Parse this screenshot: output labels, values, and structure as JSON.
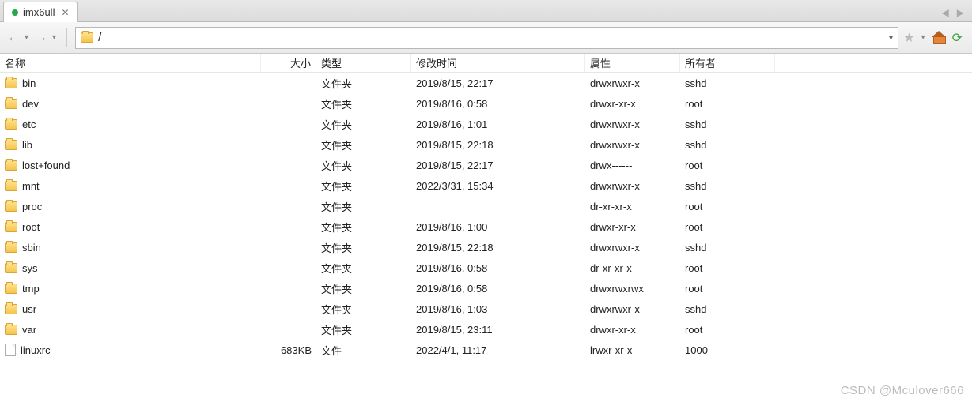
{
  "tab": {
    "title": "imx6ull"
  },
  "navbar": {
    "path": "/"
  },
  "columns": {
    "name": "名称",
    "size": "大小",
    "type": "类型",
    "mtime": "修改时间",
    "attr": "属性",
    "owner": "所有者"
  },
  "type_labels": {
    "folder": "文件夹",
    "file": "文件"
  },
  "rows": [
    {
      "icon": "folder",
      "name": "bin",
      "size": "",
      "type": "文件夹",
      "mtime": "2019/8/15, 22:17",
      "attr": "drwxrwxr-x",
      "owner": "sshd"
    },
    {
      "icon": "folder",
      "name": "dev",
      "size": "",
      "type": "文件夹",
      "mtime": "2019/8/16, 0:58",
      "attr": "drwxr-xr-x",
      "owner": "root"
    },
    {
      "icon": "folder",
      "name": "etc",
      "size": "",
      "type": "文件夹",
      "mtime": "2019/8/16, 1:01",
      "attr": "drwxrwxr-x",
      "owner": "sshd"
    },
    {
      "icon": "folder",
      "name": "lib",
      "size": "",
      "type": "文件夹",
      "mtime": "2019/8/15, 22:18",
      "attr": "drwxrwxr-x",
      "owner": "sshd"
    },
    {
      "icon": "folder",
      "name": "lost+found",
      "size": "",
      "type": "文件夹",
      "mtime": "2019/8/15, 22:17",
      "attr": "drwx------",
      "owner": "root"
    },
    {
      "icon": "folder",
      "name": "mnt",
      "size": "",
      "type": "文件夹",
      "mtime": "2022/3/31, 15:34",
      "attr": "drwxrwxr-x",
      "owner": "sshd"
    },
    {
      "icon": "folder",
      "name": "proc",
      "size": "",
      "type": "文件夹",
      "mtime": "",
      "attr": "dr-xr-xr-x",
      "owner": "root"
    },
    {
      "icon": "folder",
      "name": "root",
      "size": "",
      "type": "文件夹",
      "mtime": "2019/8/16, 1:00",
      "attr": "drwxr-xr-x",
      "owner": "root"
    },
    {
      "icon": "folder",
      "name": "sbin",
      "size": "",
      "type": "文件夹",
      "mtime": "2019/8/15, 22:18",
      "attr": "drwxrwxr-x",
      "owner": "sshd"
    },
    {
      "icon": "folder",
      "name": "sys",
      "size": "",
      "type": "文件夹",
      "mtime": "2019/8/16, 0:58",
      "attr": "dr-xr-xr-x",
      "owner": "root"
    },
    {
      "icon": "folder",
      "name": "tmp",
      "size": "",
      "type": "文件夹",
      "mtime": "2019/8/16, 0:58",
      "attr": "drwxrwxrwx",
      "owner": "root"
    },
    {
      "icon": "folder",
      "name": "usr",
      "size": "",
      "type": "文件夹",
      "mtime": "2019/8/16, 1:03",
      "attr": "drwxrwxr-x",
      "owner": "sshd"
    },
    {
      "icon": "folder",
      "name": "var",
      "size": "",
      "type": "文件夹",
      "mtime": "2019/8/15, 23:11",
      "attr": "drwxr-xr-x",
      "owner": "root"
    },
    {
      "icon": "file",
      "name": "linuxrc",
      "size": "683KB",
      "type": "文件",
      "mtime": "2022/4/1, 11:17",
      "attr": "lrwxr-xr-x",
      "owner": "1000"
    }
  ],
  "watermark": "CSDN @Mculover666"
}
